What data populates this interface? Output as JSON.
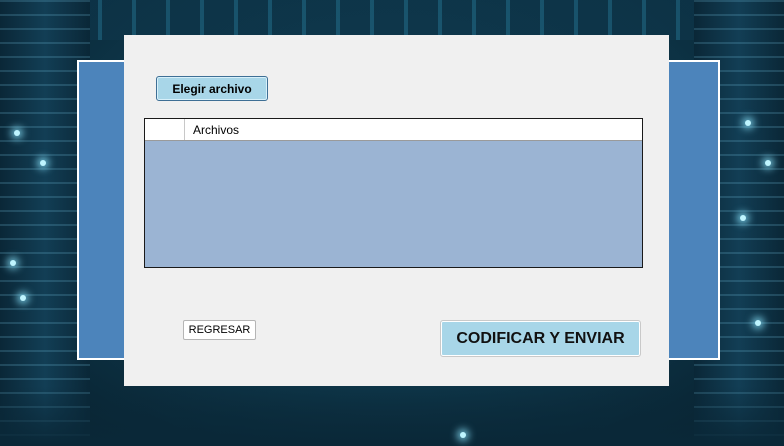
{
  "form": {
    "choose_file_label": "Elegir archivo",
    "table": {
      "columns": [
        "",
        "Archivos"
      ],
      "rows": []
    },
    "back_label": "REGRESAR",
    "submit_label": "CODIFICAR Y ENVIAR"
  },
  "colors": {
    "frame_blue": "#4c84bb",
    "panel_bg": "#f0f0f0",
    "table_bg": "#9bb4d3",
    "button_accent": "#a8d6e8"
  }
}
